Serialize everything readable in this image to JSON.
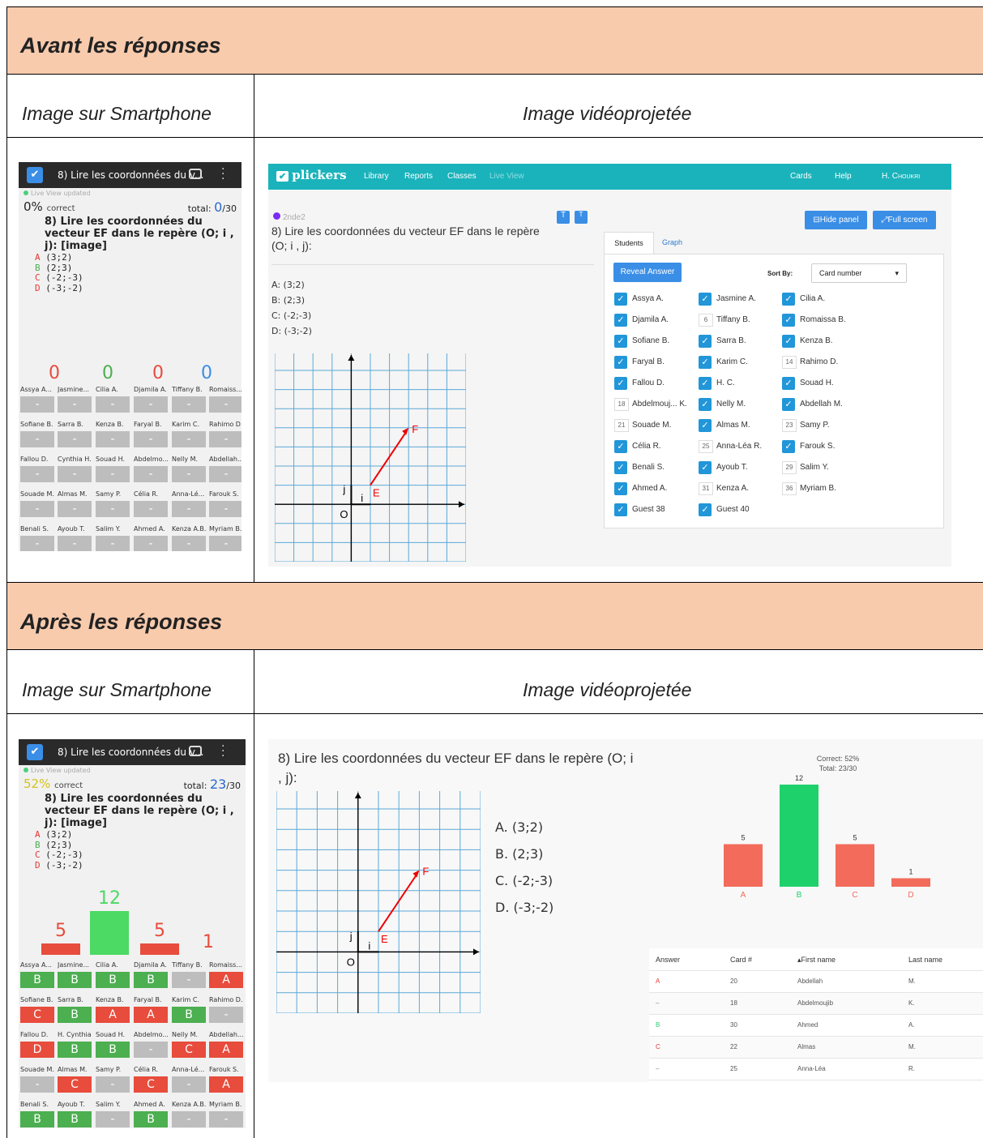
{
  "sections": {
    "before": "Avant les réponses",
    "after": "Après les réponses",
    "phone_label": "Image sur Smartphone",
    "projector_label": "Image vidéoprojetée"
  },
  "phone": {
    "title": "8) Lire les coordonnées du v...",
    "live_view": "Live View updated",
    "question": "8) Lire les coordonnées du vecteur EF dans le repère (O; i , j): [image]",
    "options": [
      {
        "letter": "A",
        "text": "(3;2)",
        "color": "#e53935"
      },
      {
        "letter": "B",
        "text": "(2;3)",
        "color": "#4caf50"
      },
      {
        "letter": "C",
        "text": "(-2;-3)",
        "color": "#e53935"
      },
      {
        "letter": "D",
        "text": "(-3;-2)",
        "color": "#e53935"
      }
    ],
    "correct_word": "correct",
    "total_word": "total:",
    "before": {
      "pct": "0%",
      "total": "0",
      "total_of": "/30",
      "counts": [
        "0",
        "0",
        "0",
        "0"
      ]
    },
    "after": {
      "pct": "52%",
      "total": "23",
      "total_of": "/30",
      "counts": [
        "5",
        "12",
        "5",
        "1"
      ]
    },
    "names": [
      "Assya A...",
      "Jasmine...",
      "Cilia A.",
      "Djamila A.",
      "Tiffany B.",
      "Romaiss...",
      "Sofiane B.",
      "Sarra B.",
      "Kenza B.",
      "Faryal B.",
      "Karim C.",
      "Rahimo D.",
      "Fallou D.",
      "Cynthia H.",
      "Souad H.",
      "Abdelmo...",
      "Nelly M.",
      "Abdellah...",
      "Souade M.",
      "Almas M.",
      "Samy P.",
      "Célia R.",
      "Anna-Lé...",
      "Farouk S.",
      "Benali S.",
      "Ayoub T.",
      "Salim Y.",
      "Ahmed A.",
      "Kenza A.B.",
      "Myriam B."
    ],
    "names_after_row3_2": "H. Cynthia",
    "answers_after": [
      "B",
      "B",
      "B",
      "B",
      "-",
      "A",
      "C",
      "B",
      "A",
      "A",
      "B",
      "-",
      "D",
      "B",
      "B",
      "-",
      "C",
      "A",
      "-",
      "C",
      "-",
      "C",
      "-",
      "A",
      "B",
      "B",
      "-",
      "B",
      "-",
      "-"
    ],
    "dash": "-"
  },
  "web": {
    "nav": {
      "logo": "plickers",
      "library": "Library",
      "reports": "Reports",
      "classes": "Classes",
      "live": "Live View",
      "cards": "Cards",
      "help": "Help",
      "user": "H. Choukri"
    },
    "class_name": "2nde2",
    "question": "8) Lire les coordonnées du vecteur EF dans le repère (O; i , j):",
    "answers": [
      "A: (3;2)",
      "B: (2;3)",
      "C: (-2;-3)",
      "D: (-3;-2)"
    ],
    "answers_big": [
      "A.  (3;2)",
      "B.  (2;3)",
      "C.  (-2;-3)",
      "D.  (-3;-2)"
    ],
    "hide_panel": "Hide panel",
    "full_screen": "Full screen",
    "tab_students": "Students",
    "tab_graph": "Graph",
    "reveal": "Reveal Answer",
    "sort_by": "Sort By:",
    "sort_value": "Card number",
    "students": [
      {
        "name": "Assya A.",
        "mark": "check"
      },
      {
        "name": "Jasmine A.",
        "mark": "check"
      },
      {
        "name": "Cilia A.",
        "mark": "check"
      },
      {
        "name": "Djamila A.",
        "mark": "check"
      },
      {
        "name": "Tiffany B.",
        "mark": "6"
      },
      {
        "name": "Romaissa B.",
        "mark": "check"
      },
      {
        "name": "Sofiane B.",
        "mark": "check"
      },
      {
        "name": "Sarra B.",
        "mark": "check"
      },
      {
        "name": "Kenza B.",
        "mark": "check"
      },
      {
        "name": "Faryal B.",
        "mark": "check"
      },
      {
        "name": "Karim C.",
        "mark": "check"
      },
      {
        "name": "Rahimo D.",
        "mark": "14"
      },
      {
        "name": "Fallou D.",
        "mark": "check"
      },
      {
        "name": "H. C.",
        "mark": "check"
      },
      {
        "name": "Souad H.",
        "mark": "check"
      },
      {
        "name": "Abdelmouj... K.",
        "mark": "18"
      },
      {
        "name": "Nelly M.",
        "mark": "check"
      },
      {
        "name": "Abdellah M.",
        "mark": "check"
      },
      {
        "name": "Souade M.",
        "mark": "21"
      },
      {
        "name": "Almas M.",
        "mark": "check"
      },
      {
        "name": "Samy P.",
        "mark": "23"
      },
      {
        "name": "Célia R.",
        "mark": "check"
      },
      {
        "name": "Anna-Léa R.",
        "mark": "25"
      },
      {
        "name": "Farouk S.",
        "mark": "check"
      },
      {
        "name": "Benali S.",
        "mark": "check"
      },
      {
        "name": "Ayoub T.",
        "mark": "check"
      },
      {
        "name": "Salim Y.",
        "mark": "29"
      },
      {
        "name": "Ahmed A.",
        "mark": "check"
      },
      {
        "name": "Kenza A.",
        "mark": "31"
      },
      {
        "name": "Myriam B.",
        "mark": "36"
      },
      {
        "name": "Guest 38",
        "mark": "check"
      },
      {
        "name": "Guest 40",
        "mark": "check"
      }
    ],
    "graph_labels": {
      "E": "E",
      "F": "F",
      "O": "O",
      "i": "i",
      "j": "j"
    },
    "results": {
      "correct": "Correct: 52%",
      "total": "Total: 23/30"
    },
    "table": {
      "headers": [
        "Answer",
        "Card #",
        "▴First name",
        "Last name"
      ],
      "rows": [
        {
          "answer": "A",
          "card": "20",
          "first": "Abdellah",
          "last": "M.",
          "color": "#e53935"
        },
        {
          "answer": "–",
          "card": "18",
          "first": "Abdelmoujib",
          "last": "K.",
          "color": "#888888"
        },
        {
          "answer": "B",
          "card": "30",
          "first": "Ahmed",
          "last": "A.",
          "color": "#2ecc71"
        },
        {
          "answer": "C",
          "card": "22",
          "first": "Almas",
          "last": "M.",
          "color": "#e53935"
        },
        {
          "answer": "–",
          "card": "25",
          "first": "Anna-Léa",
          "last": "R.",
          "color": "#888888"
        }
      ]
    }
  },
  "chart_data": {
    "type": "bar",
    "title": "",
    "categories": [
      "A",
      "B",
      "C",
      "D"
    ],
    "values": [
      5,
      12,
      5,
      1
    ],
    "colors": [
      "#f26b5b",
      "#1fd16a",
      "#f26b5b",
      "#f26b5b"
    ],
    "ylim": [
      0,
      12
    ]
  },
  "colors": {
    "red": "#e74c3c",
    "green": "#4caf50",
    "grey": "#bdbdbd",
    "teal": "#1ab3bb",
    "blue": "#3a8ee6",
    "header": "#f8cbad"
  }
}
